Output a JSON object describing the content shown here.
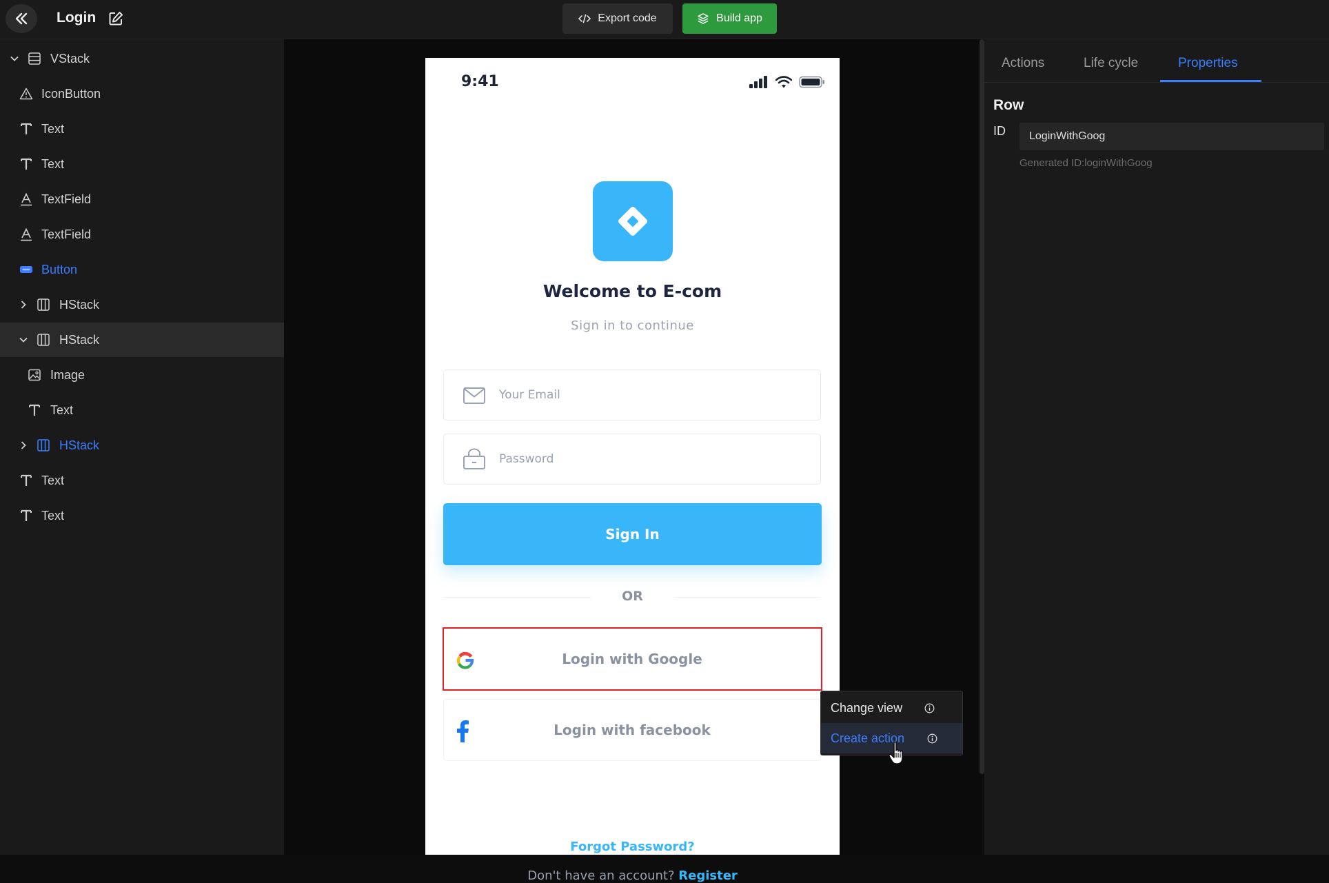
{
  "topbar": {
    "title": "Login",
    "export_label": "Export code",
    "build_label": "Build app"
  },
  "tree": {
    "items": [
      {
        "label": "VStack",
        "icon": "vstack-icon",
        "expanded": true
      },
      {
        "label": "IconButton",
        "icon": "warning-icon"
      },
      {
        "label": "Text",
        "icon": "text-icon"
      },
      {
        "label": "Text",
        "icon": "text-icon"
      },
      {
        "label": "TextField",
        "icon": "textfield-icon"
      },
      {
        "label": "TextField",
        "icon": "textfield-icon"
      },
      {
        "label": "Button",
        "icon": "button-icon"
      },
      {
        "label": "HStack",
        "icon": "hstack-icon",
        "expanded": false
      },
      {
        "label": "HStack",
        "icon": "hstack-icon",
        "expanded": true,
        "selected": true
      },
      {
        "label": "Image",
        "icon": "image-icon"
      },
      {
        "label": "Text",
        "icon": "text-icon"
      },
      {
        "label": "HStack",
        "icon": "hstack-icon",
        "expanded": false
      },
      {
        "label": "Text",
        "icon": "text-icon"
      },
      {
        "label": "Text",
        "icon": "text-icon"
      }
    ]
  },
  "phone": {
    "time": "9:41",
    "welcome": "Welcome to E-com",
    "subtitle": "Sign in to continue",
    "email_placeholder": "Your Email",
    "password_placeholder": "Password",
    "signin_label": "Sign In",
    "or_label": "OR",
    "google_label": "Login with Google",
    "facebook_label": "Login with facebook",
    "forgot_label": "Forgot Password?",
    "no_account": "Don't have an account?",
    "register_label": "Register"
  },
  "context_menu": {
    "change_view": "Change view",
    "create_action": "Create action"
  },
  "right_panel": {
    "tabs": [
      {
        "label": "Actions"
      },
      {
        "label": "Life cycle"
      },
      {
        "label": "Properties",
        "active": true
      }
    ],
    "section_title": "Row",
    "id_label": "ID",
    "id_value": "LoginWithGoog",
    "generated_id": "Generated ID:loginWithGoog"
  },
  "colors": {
    "accent_blue": "#3b7dff",
    "build_green": "#2e9a3e",
    "phone_primary": "#38b6f9",
    "highlight_red": "#e01f26"
  }
}
